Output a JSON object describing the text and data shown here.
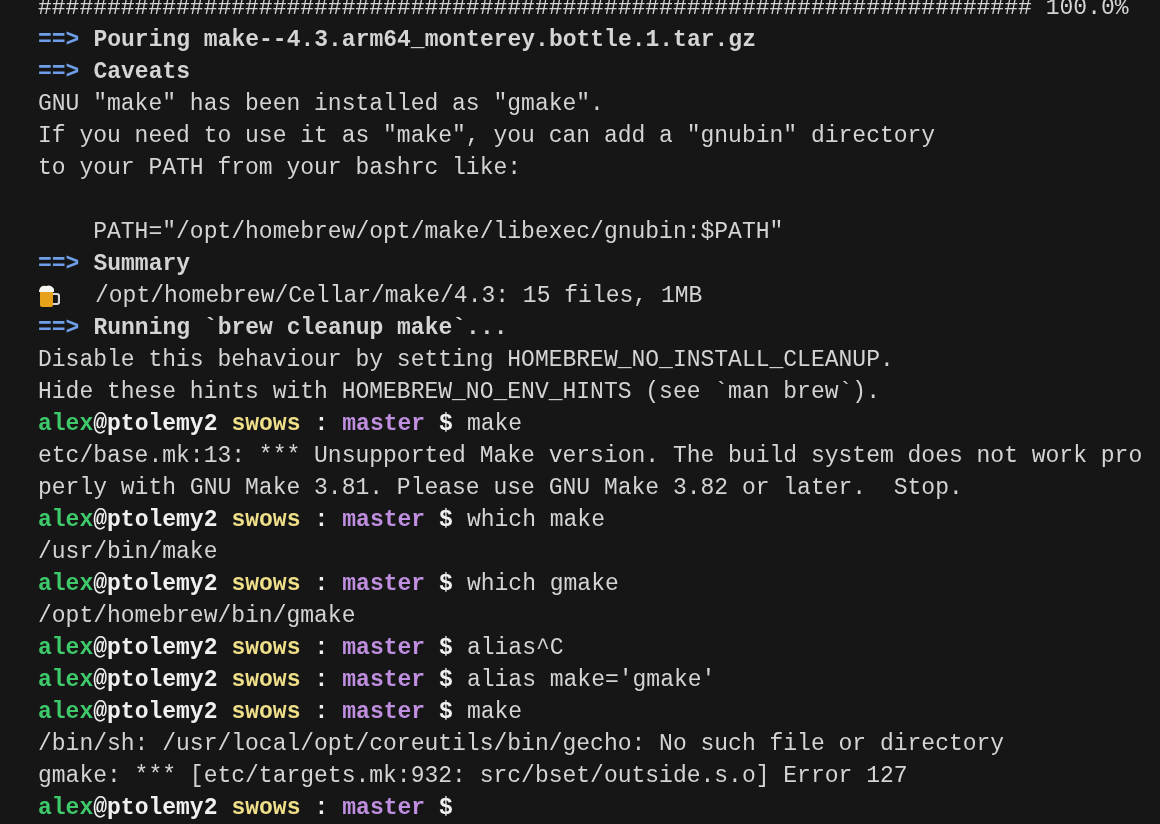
{
  "terminal": {
    "lines": [
      {
        "kind": "progress",
        "bar": "########################################################################",
        "percent": "100.0%"
      },
      {
        "kind": "header",
        "arrow": "==>",
        "text": "Pouring make--4.3.arm64_monterey.bottle.1.tar.gz"
      },
      {
        "kind": "header",
        "arrow": "==>",
        "text": "Caveats"
      },
      {
        "kind": "plain",
        "text": "GNU \"make\" has been installed as \"gmake\"."
      },
      {
        "kind": "plain",
        "text": "If you need to use it as \"make\", you can add a \"gnubin\" directory"
      },
      {
        "kind": "plain",
        "text": "to your PATH from your bashrc like:"
      },
      {
        "kind": "blank"
      },
      {
        "kind": "plain",
        "text": "    PATH=\"/opt/homebrew/opt/make/libexec/gnubin:$PATH\""
      },
      {
        "kind": "header",
        "arrow": "==>",
        "text": "Summary"
      },
      {
        "kind": "beer",
        "text": "/opt/homebrew/Cellar/make/4.3: 15 files, 1MB"
      },
      {
        "kind": "header",
        "arrow": "==>",
        "text": "Running `brew cleanup make`..."
      },
      {
        "kind": "plain",
        "text": "Disable this behaviour by setting HOMEBREW_NO_INSTALL_CLEANUP."
      },
      {
        "kind": "plain",
        "text": "Hide these hints with HOMEBREW_NO_ENV_HINTS (see `man brew`)."
      },
      {
        "kind": "prompt",
        "user": "alex",
        "host": "@ptolemy2",
        "dir": "swows",
        "sep": ":",
        "branch": "master",
        "sigil": "$",
        "command": "make"
      },
      {
        "kind": "plain",
        "text": "etc/base.mk:13: *** Unsupported Make version. The build system does not work pro"
      },
      {
        "kind": "plain",
        "text": "perly with GNU Make 3.81. Please use GNU Make 3.82 or later.  Stop."
      },
      {
        "kind": "prompt",
        "user": "alex",
        "host": "@ptolemy2",
        "dir": "swows",
        "sep": ":",
        "branch": "master",
        "sigil": "$",
        "command": "which make"
      },
      {
        "kind": "plain",
        "text": "/usr/bin/make"
      },
      {
        "kind": "prompt",
        "user": "alex",
        "host": "@ptolemy2",
        "dir": "swows",
        "sep": ":",
        "branch": "master",
        "sigil": "$",
        "command": "which gmake"
      },
      {
        "kind": "plain",
        "text": "/opt/homebrew/bin/gmake"
      },
      {
        "kind": "prompt",
        "user": "alex",
        "host": "@ptolemy2",
        "dir": "swows",
        "sep": ":",
        "branch": "master",
        "sigil": "$",
        "command": "alias^C"
      },
      {
        "kind": "prompt",
        "user": "alex",
        "host": "@ptolemy2",
        "dir": "swows",
        "sep": ":",
        "branch": "master",
        "sigil": "$",
        "command": "alias make='gmake'"
      },
      {
        "kind": "prompt",
        "user": "alex",
        "host": "@ptolemy2",
        "dir": "swows",
        "sep": ":",
        "branch": "master",
        "sigil": "$",
        "command": "make"
      },
      {
        "kind": "plain",
        "text": "/bin/sh: /usr/local/opt/coreutils/bin/gecho: No such file or directory"
      },
      {
        "kind": "plain",
        "text": "gmake: *** [etc/targets.mk:932: src/bset/outside.s.o] Error 127"
      },
      {
        "kind": "prompt",
        "user": "alex",
        "host": "@ptolemy2",
        "dir": "swows",
        "sep": ":",
        "branch": "master",
        "sigil": "$"
      }
    ]
  }
}
